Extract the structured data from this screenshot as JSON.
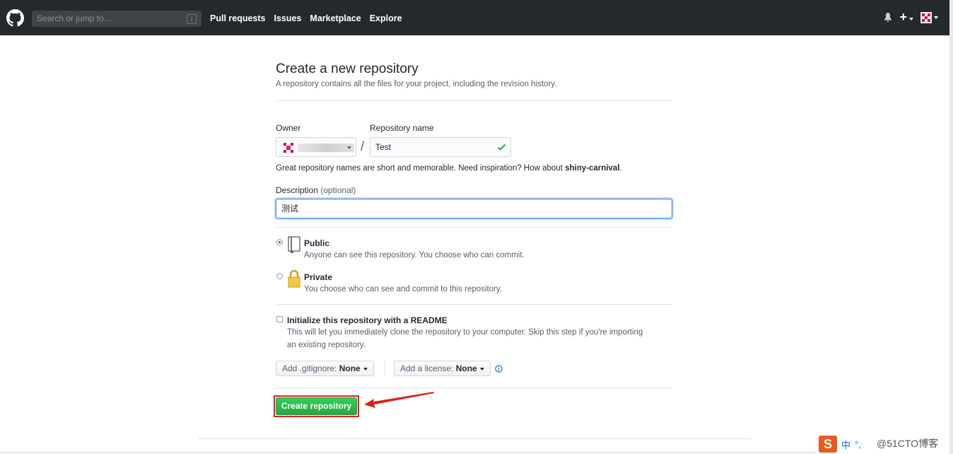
{
  "topbar": {
    "search_placeholder": "Search or jump to...",
    "search_shortcut": "/",
    "nav": [
      "Pull requests",
      "Issues",
      "Marketplace",
      "Explore"
    ],
    "plus": "+"
  },
  "page": {
    "title": "Create a new repository",
    "subtitle": "A repository contains all the files for your project, including the revision history."
  },
  "form": {
    "owner_label": "Owner",
    "repo_label": "Repository name",
    "separator": "/",
    "repo_value": "Test",
    "hint_prefix": "Great repository names are short and memorable. Need inspiration? How about ",
    "hint_suggestion": "shiny-carnival",
    "hint_suffix": ".",
    "desc_label": "Description",
    "desc_optional": "(optional)",
    "desc_value": "测试",
    "visibility": {
      "selected": "Public",
      "public_title": "Public",
      "public_desc": "Anyone can see this repository. You choose who can commit.",
      "private_title": "Private",
      "private_desc": "You choose who can see and commit to this repository."
    },
    "readme_title": "Initialize this repository with a README",
    "readme_desc_1": "This will let you immediately clone the repository to your computer. Skip this step if you're importing",
    "readme_desc_2": "an existing repository.",
    "gitignore_label": "Add .gitignore:",
    "gitignore_value": "None",
    "license_label": "Add a license:",
    "license_value": "None",
    "create_button": "Create repository"
  },
  "ime": {
    "lang": "中",
    "punct": "°,"
  },
  "watermark": "@51CTO博客",
  "colors": {
    "topbar": "#24292e",
    "create_button": "#28a745",
    "highlight": "#e0201c",
    "focus": "#2188ff"
  }
}
